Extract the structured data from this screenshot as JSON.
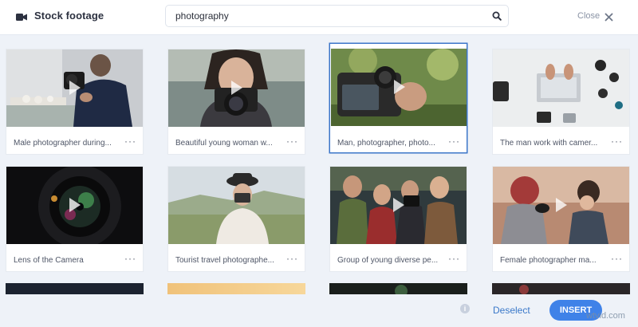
{
  "header": {
    "title": "Stock footage",
    "search_value": "photography",
    "close_label": "Close"
  },
  "cards": [
    {
      "label": "Male photographer during...",
      "more": "···"
    },
    {
      "label": "Beautiful young woman w...",
      "more": "···"
    },
    {
      "label": "Man, photographer, photo...",
      "more": "···",
      "selected": true
    },
    {
      "label": "The man work with camer...",
      "more": "···"
    },
    {
      "label": "Lens of the Camera",
      "more": "···"
    },
    {
      "label": "Tourist travel photographe...",
      "more": "···"
    },
    {
      "label": "Group of young diverse pe...",
      "more": "···"
    },
    {
      "label": "Female photographer ma...",
      "more": "···"
    }
  ],
  "footer": {
    "info_glyph": "i",
    "deselect_label": "Deselect",
    "insert_label": "INSERT"
  },
  "watermark": "wtvid.com",
  "colors": {
    "accent": "#3f82e8",
    "selected_border": "#3c76c9",
    "background": "#eef2f8"
  }
}
